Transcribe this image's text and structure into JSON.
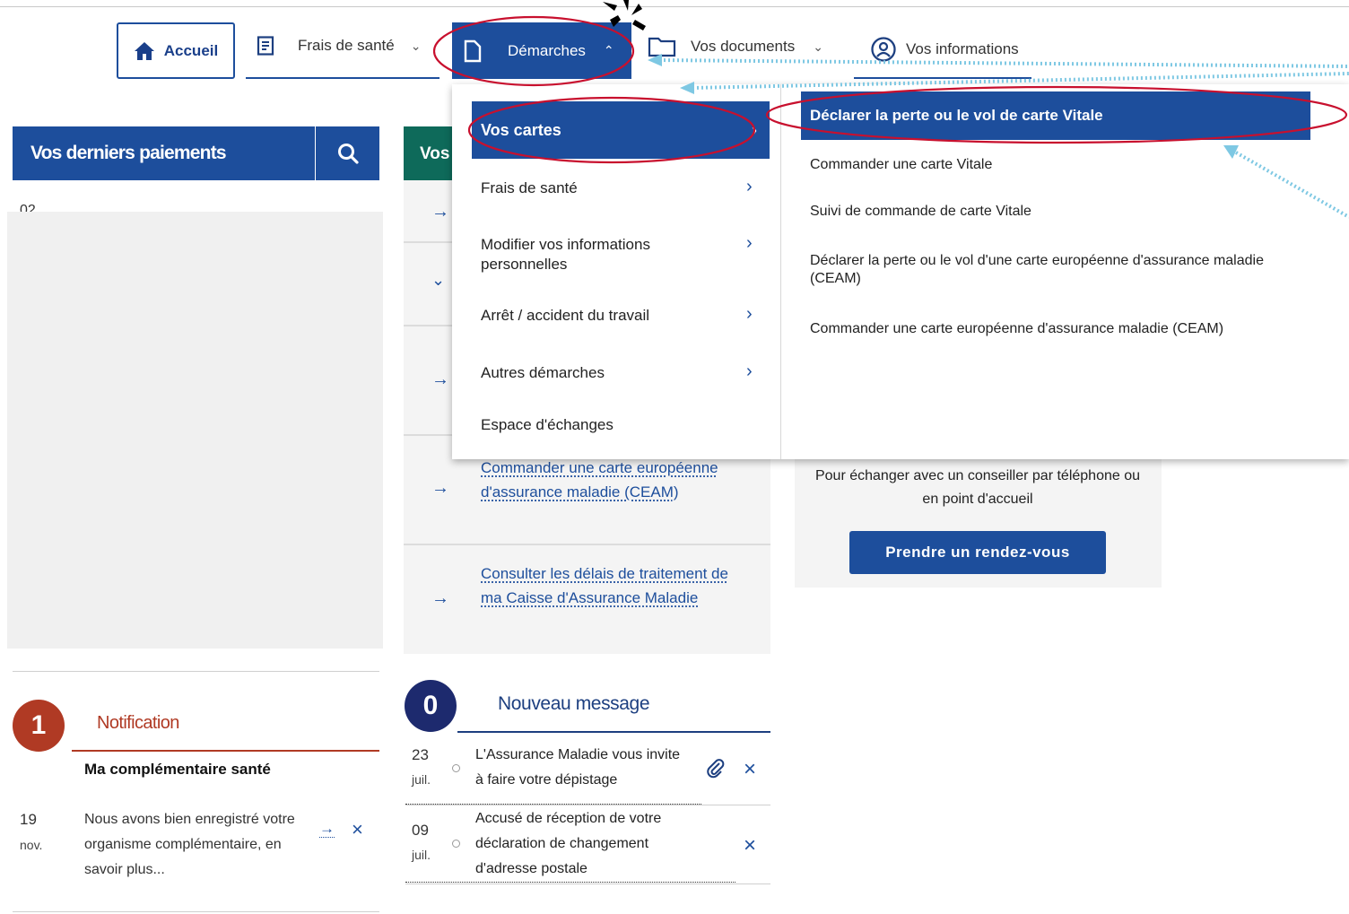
{
  "nav": {
    "home": "Accueil",
    "frais": "Frais de santé",
    "demarches": "Démarches",
    "documents": "Vos documents",
    "infos": "Vos informations"
  },
  "payments": {
    "title": "Vos derniers paiements",
    "partial_date": "02"
  },
  "mid": {
    "header_partial": "Vos",
    "links": [
      "Commander une carte européenne d'assurance maladie (CEAM)",
      "Consulter les délais de traitement de ma Caisse d'Assurance Maladie"
    ]
  },
  "notification": {
    "count": "1",
    "title": "Notification",
    "subject": "Ma complémentaire santé",
    "text": "Nous avons bien enregistré votre organisme complémentaire, en savoir plus...",
    "day": "19",
    "month": "nov."
  },
  "messages": {
    "count": "0",
    "title": "Nouveau message",
    "items": [
      {
        "day": "23",
        "month": "juil.",
        "text": "L'Assurance Maladie vous invite à faire votre dépistage"
      },
      {
        "day": "09",
        "month": "juil.",
        "text": "Accusé de réception de votre déclaration de changement d'adresse postale"
      }
    ]
  },
  "rdv": {
    "text": "Pour échanger avec un conseiller par téléphone ou en point d'accueil",
    "button": "Prendre un rendez-vous"
  },
  "dropdown": {
    "submenu": [
      "Vos cartes",
      "Frais de santé",
      "Modifier vos informations personnelles",
      "Arrêt / accident du travail",
      "Autres démarches",
      "Espace d'échanges"
    ],
    "cards_menu": [
      "Déclarer la perte ou le vol de carte Vitale",
      "Commander une carte Vitale",
      "Suivi de commande de carte Vitale",
      "Déclarer la perte ou le vol d'une carte européenne d'assurance maladie (CEAM)",
      "Commander une carte européenne d'assurance maladie (CEAM)"
    ]
  },
  "colors": {
    "primary": "#1d4e9c",
    "annotation_red": "#c8102e",
    "annotation_dots": "#7ec8e3",
    "notification": "#b03a24",
    "messages": "#1d2a6e"
  }
}
